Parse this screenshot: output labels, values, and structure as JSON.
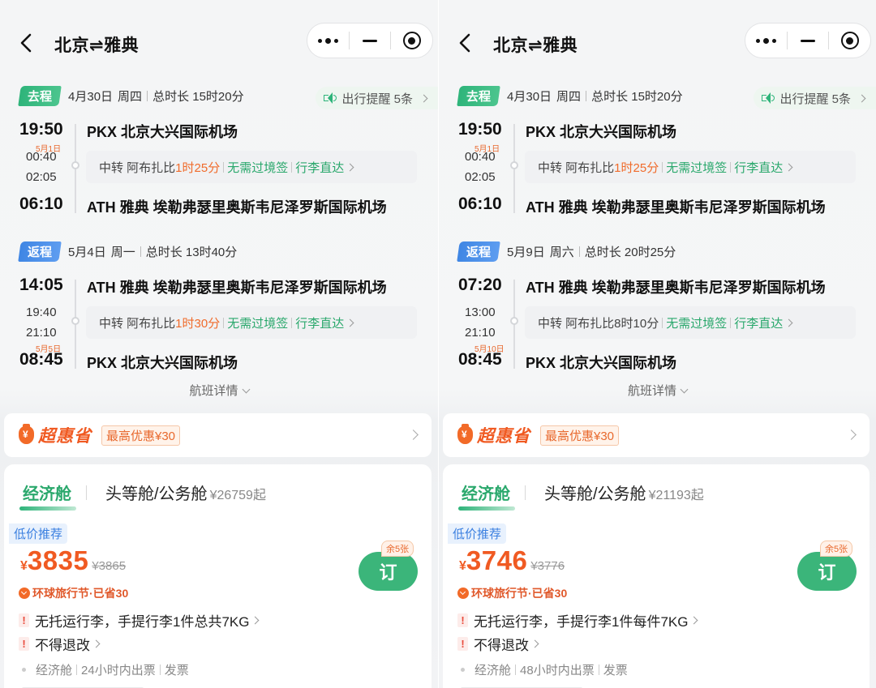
{
  "panes": [
    {
      "header": {
        "title": "北京⇌雅典"
      },
      "outbound": {
        "tag": "去程",
        "date": "4月30日",
        "weekday": "周四",
        "duration": "总时长 15时20分",
        "reminder": "出行提醒 5条",
        "depart_time": "19:50",
        "depart_airport": "PKX 北京大兴国际机场",
        "transfer_arrive_tag": "5月1日",
        "transfer_arrive": "00:40",
        "transfer_depart": "02:05",
        "arrive_time": "06:10",
        "arrive_airport": "ATH 雅典 埃勒弗瑟里奥斯韦尼泽罗斯国际机场",
        "transfer_label": "中转 阿布扎比",
        "transfer_duration": "1时25分",
        "transfer_duration_highlight": true,
        "no_visa": "无需过境签",
        "baggage_through": "行李直达"
      },
      "return": {
        "tag": "返程",
        "date": "5月4日",
        "weekday": "周一",
        "duration": "总时长 13时40分",
        "depart_time": "14:05",
        "depart_airport": "ATH 雅典 埃勒弗瑟里奥斯韦尼泽罗斯国际机场",
        "transfer_arrive_tag": "",
        "transfer_arrive": "19:40",
        "transfer_depart": "21:10",
        "arrive_tag": "5月5日",
        "arrive_time": "08:45",
        "arrive_airport": "PKX 北京大兴国际机场",
        "transfer_label": "中转 阿布扎比",
        "transfer_duration": "1时30分",
        "transfer_duration_highlight": true,
        "no_visa": "无需过境签",
        "baggage_through": "行李直达"
      },
      "flight_details": "航班详情",
      "promo": {
        "brand": "超惠省",
        "max_discount": "最高优惠¥30"
      },
      "cabins": {
        "economy": "经济舱",
        "first": "头等舱/公务舱",
        "first_price": "¥26759起",
        "badge": "低价推荐",
        "price_symbol": "¥",
        "price": "3835",
        "original_price": "¥3865",
        "saved": "环球旅行节·已省30",
        "book": "订",
        "seats_left": "余5张",
        "rule1": "无托运行李，手提行李1件总共7KG",
        "rule2": "不得退改",
        "footer_cabin": "经济舱",
        "footer_issue": "24小时内出票",
        "footer_invoice": "发票"
      }
    },
    {
      "header": {
        "title": "北京⇌雅典"
      },
      "outbound": {
        "tag": "去程",
        "date": "4月30日",
        "weekday": "周四",
        "duration": "总时长 15时20分",
        "reminder": "出行提醒 5条",
        "depart_time": "19:50",
        "depart_airport": "PKX 北京大兴国际机场",
        "transfer_arrive_tag": "5月1日",
        "transfer_arrive": "00:40",
        "transfer_depart": "02:05",
        "arrive_time": "06:10",
        "arrive_airport": "ATH 雅典 埃勒弗瑟里奥斯韦尼泽罗斯国际机场",
        "transfer_label": "中转 阿布扎比",
        "transfer_duration": "1时25分",
        "transfer_duration_highlight": true,
        "no_visa": "无需过境签",
        "baggage_through": "行李直达"
      },
      "return": {
        "tag": "返程",
        "date": "5月9日",
        "weekday": "周六",
        "duration": "总时长 20时25分",
        "depart_time": "07:20",
        "depart_airport": "ATH 雅典 埃勒弗瑟里奥斯韦尼泽罗斯国际机场",
        "transfer_arrive_tag": "",
        "transfer_arrive": "13:00",
        "transfer_depart": "21:10",
        "arrive_tag": "5月10日",
        "arrive_time": "08:45",
        "arrive_airport": "PKX 北京大兴国际机场",
        "transfer_label": "中转 阿布扎比",
        "transfer_duration": "8时10分",
        "transfer_duration_highlight": false,
        "no_visa": "无需过境签",
        "baggage_through": "行李直达"
      },
      "flight_details": "航班详情",
      "promo": {
        "brand": "超惠省",
        "max_discount": "最高优惠¥30"
      },
      "cabins": {
        "economy": "经济舱",
        "first": "头等舱/公务舱",
        "first_price": "¥21193起",
        "badge": "低价推荐",
        "price_symbol": "¥",
        "price": "3746",
        "original_price": "¥3776",
        "saved": "环球旅行节·已省30",
        "book": "订",
        "seats_left": "余5张",
        "rule1": "无托运行李，手提行李1件每件7KG",
        "rule2": "不得退改",
        "footer_cabin": "经济舱",
        "footer_issue": "48小时内出票",
        "footer_invoice": "发票"
      }
    }
  ]
}
